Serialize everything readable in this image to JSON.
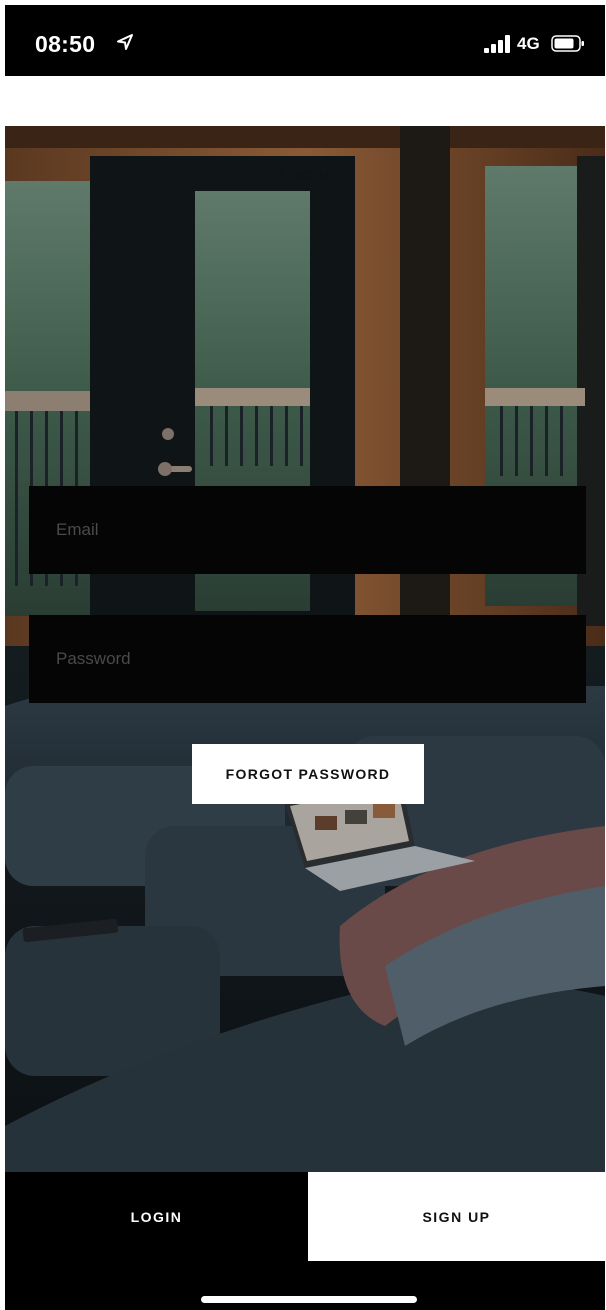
{
  "status_bar": {
    "time": "08:50",
    "network": "4G",
    "icons": [
      "location-arrow-icon",
      "signal-bars-icon",
      "battery-icon"
    ]
  },
  "screen": {
    "title": "LOGIN"
  },
  "form": {
    "email_placeholder": "Email",
    "password_placeholder": "Password",
    "forgot_label": "FORGOT PASSWORD"
  },
  "tabs": {
    "login_label": "LOGIN",
    "signup_label": "SIGN UP"
  },
  "colors": {
    "background_dark": "#000000",
    "field_background": "#050505",
    "accent_light": "#ffffff"
  }
}
